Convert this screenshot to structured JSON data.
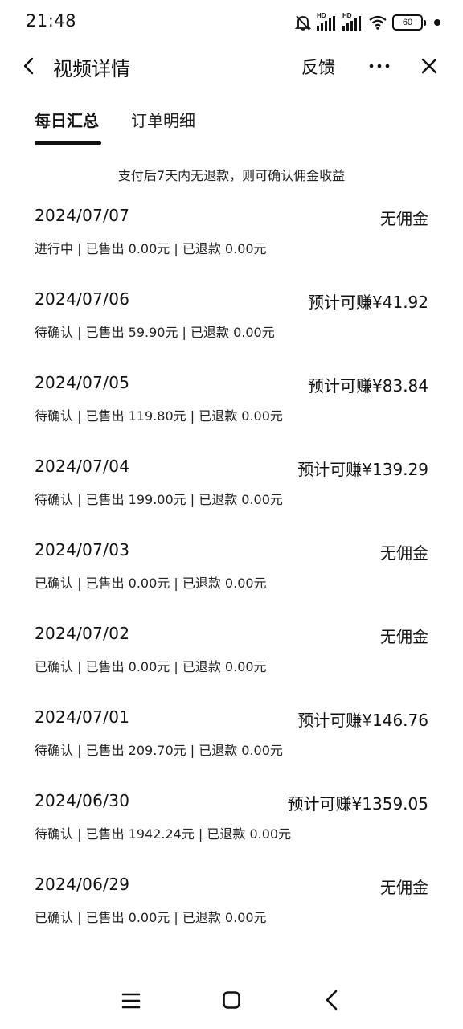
{
  "status_bar": {
    "time": "21:48",
    "battery": "60",
    "hd": "HD"
  },
  "header": {
    "title": "视频详情",
    "feedback": "反馈"
  },
  "tabs": [
    {
      "label": "每日汇总",
      "active": true
    },
    {
      "label": "订单明细",
      "active": false
    }
  ],
  "notice": "支付后7天内无退款，则可确认佣金收益",
  "rows": [
    {
      "date": "2024/07/07",
      "amount": "无佣金",
      "detail": "进行中 | 已售出 0.00元 | 已退款 0.00元"
    },
    {
      "date": "2024/07/06",
      "amount": "预计可赚¥41.92",
      "detail": "待确认 | 已售出 59.90元 | 已退款 0.00元"
    },
    {
      "date": "2024/07/05",
      "amount": "预计可赚¥83.84",
      "detail": "待确认 | 已售出 119.80元 | 已退款 0.00元"
    },
    {
      "date": "2024/07/04",
      "amount": "预计可赚¥139.29",
      "detail": "待确认 | 已售出 199.00元 | 已退款 0.00元"
    },
    {
      "date": "2024/07/03",
      "amount": "无佣金",
      "detail": "已确认 | 已售出 0.00元 | 已退款 0.00元"
    },
    {
      "date": "2024/07/02",
      "amount": "无佣金",
      "detail": "已确认 | 已售出 0.00元 | 已退款 0.00元"
    },
    {
      "date": "2024/07/01",
      "amount": "预计可赚¥146.76",
      "detail": "待确认 | 已售出 209.70元 | 已退款 0.00元"
    },
    {
      "date": "2024/06/30",
      "amount": "预计可赚¥1359.05",
      "detail": "待确认 | 已售出 1942.24元 | 已退款 0.00元"
    },
    {
      "date": "2024/06/29",
      "amount": "无佣金",
      "detail": "已确认 | 已售出 0.00元 | 已退款 0.00元"
    }
  ],
  "icons": {
    "back": "chevron-left-icon",
    "more": "more-horizontal-icon",
    "close": "close-icon",
    "nav_menu": "menu-icon",
    "nav_home": "square-home-icon",
    "nav_back": "chevron-left-icon"
  }
}
